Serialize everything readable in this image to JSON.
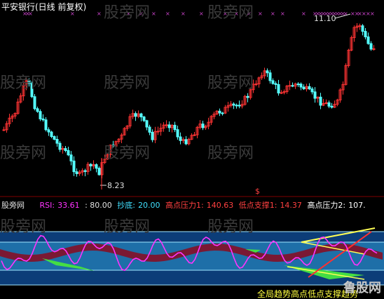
{
  "header": {
    "title": "平安银行(日线 前复权)"
  },
  "watermark": {
    "text": "股旁网"
  },
  "price_labels": {
    "high": "11.10",
    "low": "8.23"
  },
  "signal_marker": "$",
  "indicator": {
    "name": "股旁网",
    "rsi_label": "RSI:",
    "rsi_value": "33.61",
    "overbought": ": 80.00",
    "buy_label": "抄底:",
    "buy_value": "20.00",
    "pressure1_label": "高点压力1:",
    "pressure1_value": "140.63",
    "support1_label": "低点支撑1:",
    "support1_value": "14.37",
    "pressure2_label": "高点压力2:",
    "pressure2_value": "107."
  },
  "footer_text": "全局趋势高点低点支撑趋势",
  "logo_text": "鲁股网",
  "colors": {
    "up": "#ff3333",
    "down": "#54ffff",
    "rsi_line": "#ff33ff",
    "band_fill": "#1e6fa8",
    "band_bg": "#0c3d78",
    "hline": "#9fe6ff",
    "top_marks": "#cc44cc",
    "label_red": "#ff4040",
    "label_yellow": "#ffff40",
    "label_cyan": "#40e0ff"
  }
}
